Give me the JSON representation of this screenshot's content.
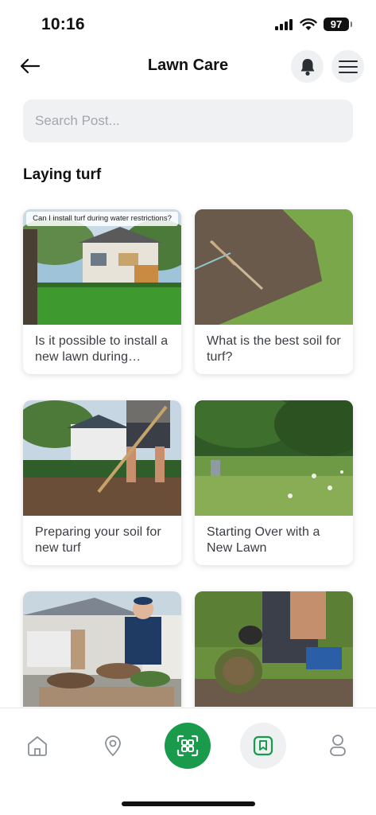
{
  "status_bar": {
    "time": "10:16",
    "battery": "97",
    "icons": [
      "cellular-signal-icon",
      "wifi-icon",
      "battery-icon"
    ]
  },
  "header": {
    "title": "Lawn Care",
    "back_icon": "arrow-left-icon",
    "notification_icon": "bell-icon",
    "menu_icon": "hamburger-menu-icon"
  },
  "search": {
    "value": "",
    "placeholder": "Search Post..."
  },
  "section": {
    "title": "Laying turf"
  },
  "posts": [
    {
      "title": "Is it possible to install a new lawn during…",
      "image_caption": "Can I install turf during water restrictions?"
    },
    {
      "title": "What is the best soil for turf?"
    },
    {
      "title": "Preparing your soil for new turf"
    },
    {
      "title": "Starting Over with a New Lawn"
    },
    {
      "title": ""
    },
    {
      "title": ""
    }
  ],
  "bottom_nav": {
    "items": [
      "home-icon",
      "location-pin-icon",
      "scan-icon",
      "bookmark-icon",
      "profile-icon"
    ],
    "active": "scan-icon",
    "accent_color": "#1a9a4b"
  }
}
